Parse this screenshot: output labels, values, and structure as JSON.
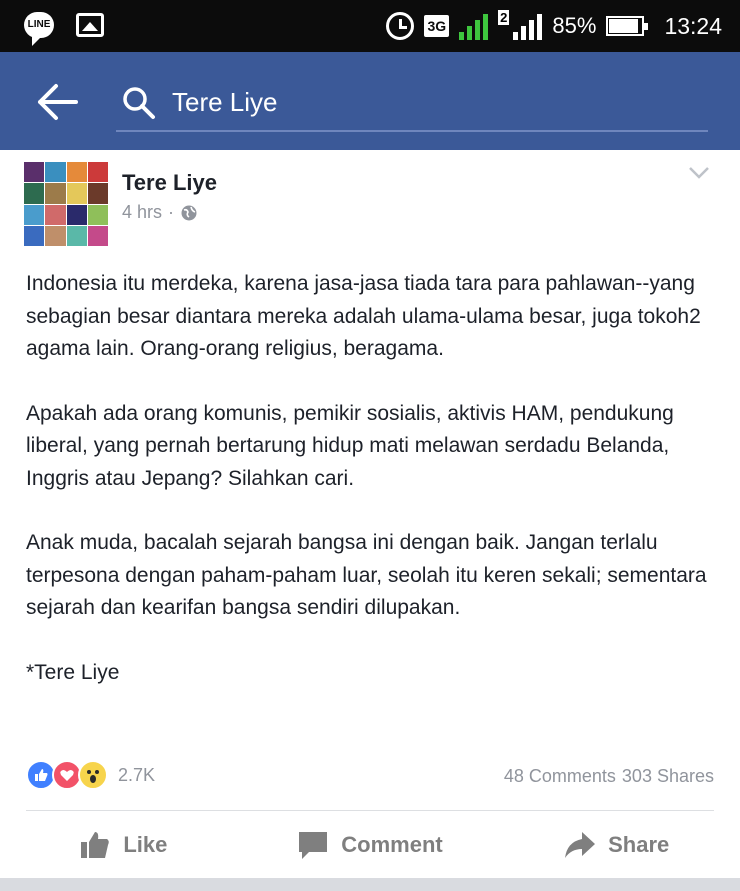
{
  "status_bar": {
    "line_label": "LINE",
    "network": "3G",
    "sim2": "2",
    "battery": "85%",
    "time": "13:24"
  },
  "app_bar": {
    "search_value": "Tere Liye"
  },
  "post": {
    "author": "Tere Liye",
    "time": "4 hrs",
    "separator": "·",
    "paragraphs": [
      "Indonesia itu merdeka, karena jasa-jasa tiada tara para pahlawan--yang sebagian besar diantara mereka adalah ulama-ulama besar, juga tokoh2 agama lain. Orang-orang religius, beragama.",
      "Apakah ada orang komunis, pemikir sosialis, aktivis HAM, pendukung liberal, yang pernah bertarung hidup mati melawan serdadu Belanda, Inggris atau Jepang? Silahkan cari.",
      "Anak muda, bacalah sejarah bangsa ini dengan baik. Jangan terlalu terpesona dengan paham-paham luar, seolah itu keren sekali; sementara sejarah dan kearifan bangsa sendiri dilupakan."
    ],
    "signature": "*Tere Liye",
    "reaction_count": "2.7K",
    "comments": "48 Comments",
    "shares": "303 Shares"
  },
  "actions": {
    "like": "Like",
    "comment": "Comment",
    "share": "Share"
  },
  "colors": {
    "facebook_blue": "#3b5998",
    "text": "#1d2129",
    "muted": "#90949c",
    "like_reaction": "#4080ff",
    "love_reaction": "#f25268",
    "wow_reaction": "#f7d44c"
  },
  "icons": [
    "line-app-icon",
    "photo-icon",
    "alarm-icon",
    "battery-icon",
    "back-arrow-icon",
    "search-icon",
    "globe-icon",
    "chevron-down-icon",
    "like-reaction-icon",
    "love-reaction-icon",
    "wow-reaction-icon",
    "thumbs-up-icon",
    "comment-icon",
    "share-arrow-icon"
  ]
}
